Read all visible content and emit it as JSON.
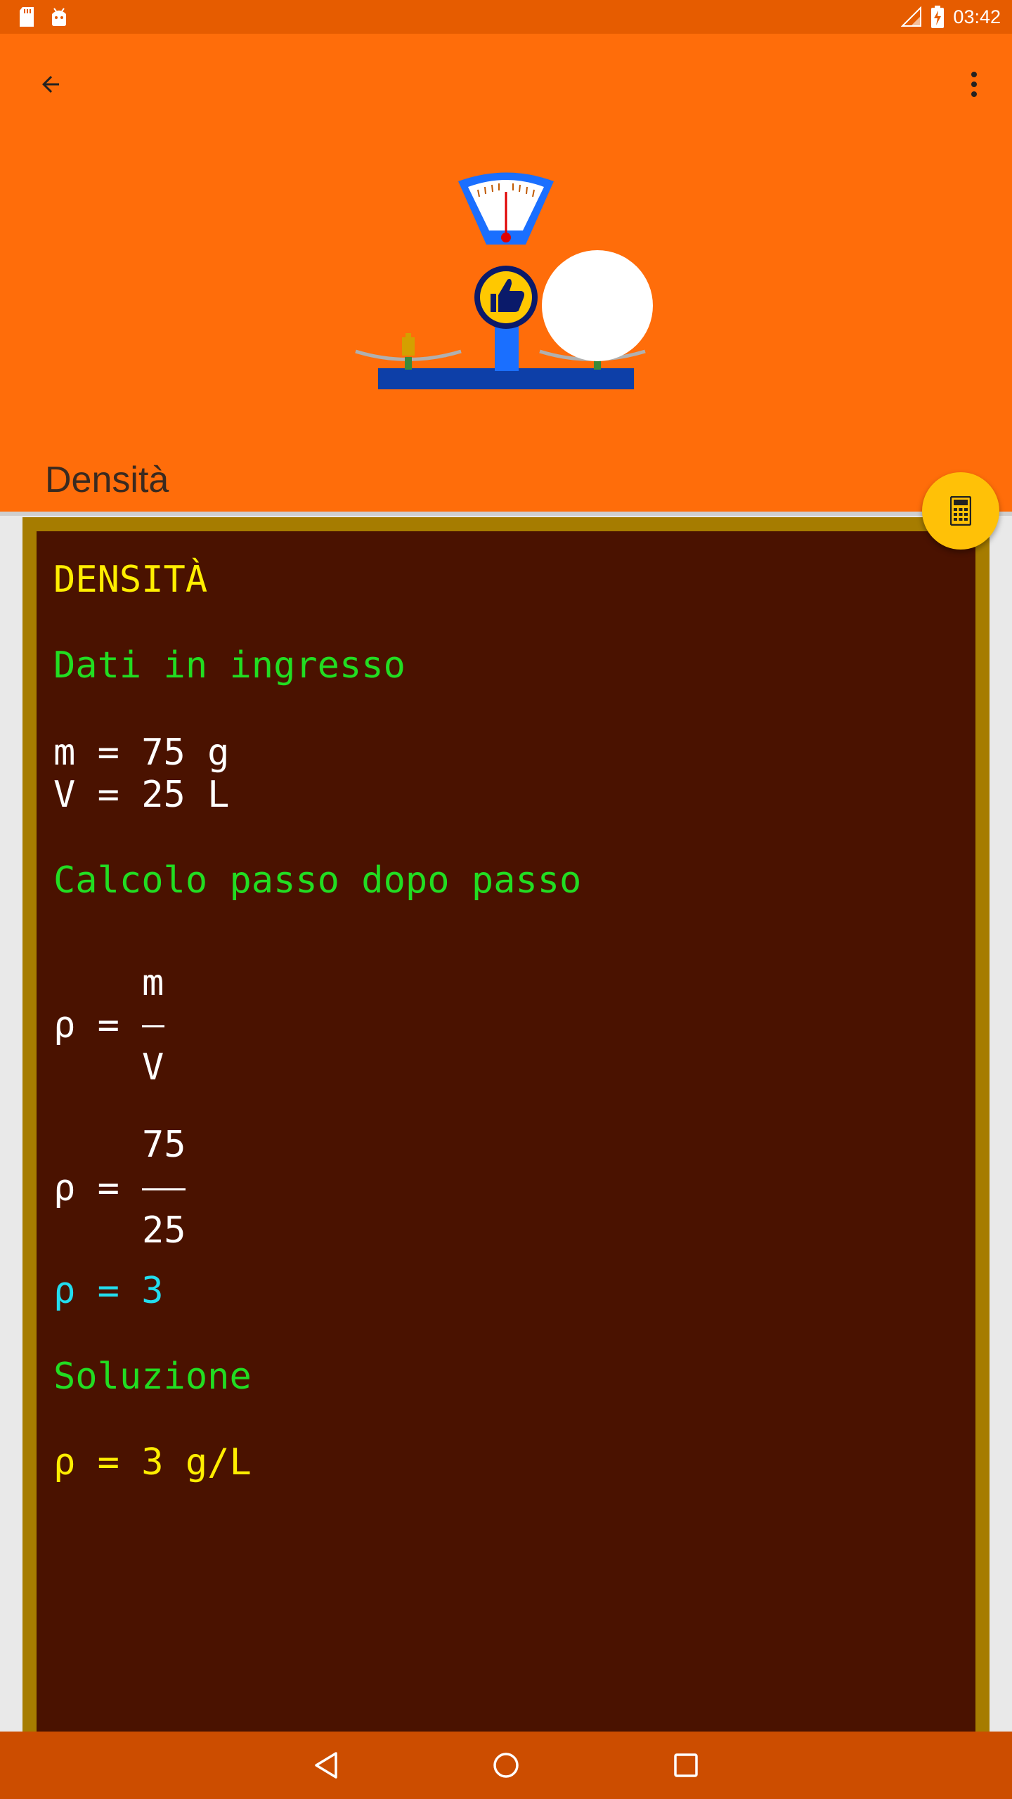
{
  "status_bar": {
    "time": "03:42",
    "icons": [
      "sd-card-icon",
      "android-debug-icon",
      "signal-icon",
      "battery-charging-icon"
    ]
  },
  "app_bar": {
    "title": "Densità",
    "back_icon": "arrow-back-icon",
    "menu_icon": "more-vert-icon",
    "hero_image": "scale-balance-illustration"
  },
  "fab": {
    "icon": "calculator-icon"
  },
  "content": {
    "heading": "DENSITÀ",
    "input_title": "Dati in ingresso",
    "inputs": [
      "m = 75 g",
      "V = 25 L"
    ],
    "steps_title": "Calcolo passo dopo passo",
    "formula": {
      "lhs": "ρ =",
      "numerator": "m",
      "denominator": "V"
    },
    "substitution": {
      "lhs": "ρ =",
      "numerator": "75",
      "denominator": "25"
    },
    "step_result": "ρ = 3",
    "solution_title": "Soluzione",
    "solution": "ρ = 3 g/L"
  },
  "nav_bar": {
    "icons": [
      "nav-back-icon",
      "nav-home-icon",
      "nav-recents-icon"
    ]
  },
  "colors": {
    "status_bar": "#e65c00",
    "app_bar": "#ff6d0a",
    "fab": "#ffc107",
    "board": "#4a1200",
    "board_frame": "#a67c00",
    "nav_bar": "#cc4d00"
  }
}
